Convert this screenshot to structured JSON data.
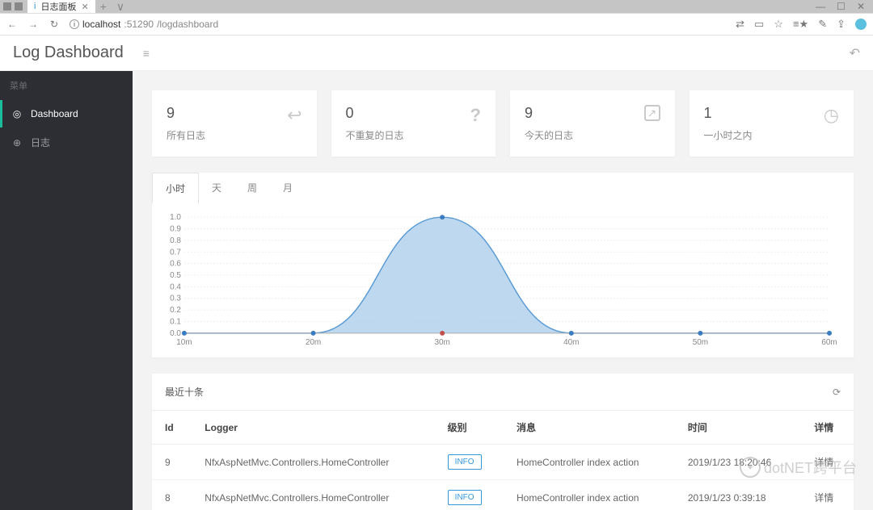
{
  "browser": {
    "tab_title": "日志面板",
    "url_host": "localhost",
    "url_port": ":51290",
    "url_path": "/logdashboard",
    "window_minimize": "—",
    "window_maximize": "☐",
    "window_close": "✕"
  },
  "app": {
    "title": "Log Dashboard"
  },
  "sidebar": {
    "section": "菜单",
    "items": [
      {
        "icon": "◎",
        "label": "Dashboard",
        "active": true
      },
      {
        "icon": "⊕",
        "label": "日志",
        "active": false
      }
    ]
  },
  "cards": [
    {
      "value": "9",
      "label": "所有日志",
      "icon": "↩"
    },
    {
      "value": "0",
      "label": "不重复的日志",
      "icon": "?"
    },
    {
      "value": "9",
      "label": "今天的日志",
      "icon": "↗"
    },
    {
      "value": "1",
      "label": "一小时之内",
      "icon": "◷"
    }
  ],
  "chart": {
    "tabs": [
      "小时",
      "天",
      "周",
      "月"
    ],
    "active_tab": 0
  },
  "chart_data": {
    "type": "area",
    "title": "",
    "xlabel": "",
    "ylabel": "",
    "ylim": [
      0,
      1.0
    ],
    "y_ticks": [
      0,
      0.1,
      0.2,
      0.3,
      0.4,
      0.5,
      0.6,
      0.7,
      0.8,
      0.9,
      1.0
    ],
    "categories": [
      "10m",
      "20m",
      "30m",
      "40m",
      "50m",
      "60m"
    ],
    "values": [
      0,
      0,
      1.0,
      0,
      0,
      0
    ]
  },
  "recent": {
    "title": "最近十条",
    "columns": [
      "Id",
      "Logger",
      "级别",
      "消息",
      "时间",
      "详情"
    ],
    "rows": [
      {
        "id": "9",
        "logger": "NfxAspNetMvc.Controllers.HomeController",
        "level": "INFO",
        "message": "HomeController index action",
        "time": "2019/1/23 18:20:46",
        "detail": "详情"
      },
      {
        "id": "8",
        "logger": "NfxAspNetMvc.Controllers.HomeController",
        "level": "INFO",
        "message": "HomeController index action",
        "time": "2019/1/23 0:39:18",
        "detail": "详情"
      }
    ]
  },
  "watermark": "dotNET跨平台"
}
